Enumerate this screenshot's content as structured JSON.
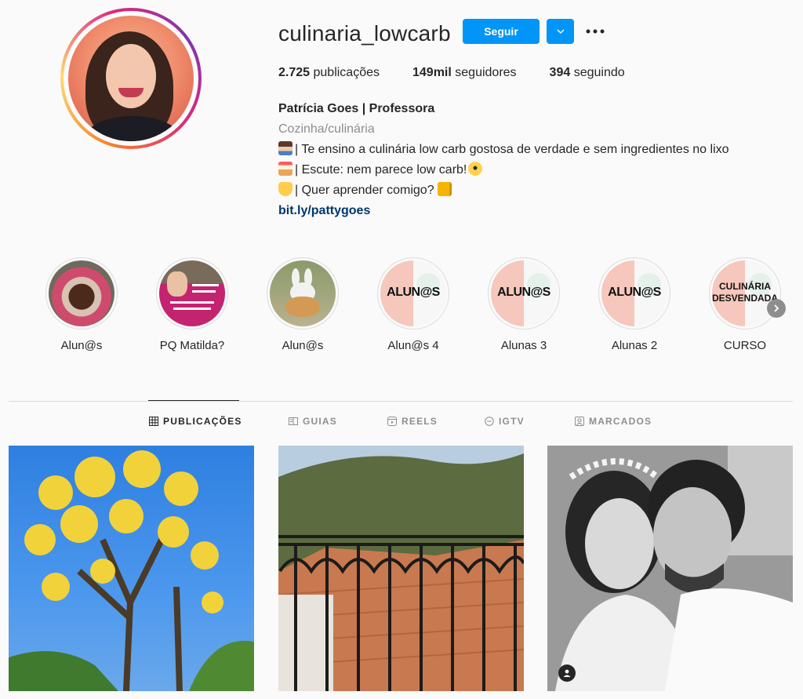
{
  "profile": {
    "username": "culinaria_lowcarb",
    "follow_label": "Seguir",
    "stats": {
      "posts_count": "2.725",
      "posts_label": "publicações",
      "followers_count": "149mil",
      "followers_label": "seguidores",
      "following_count": "394",
      "following_label": "seguindo"
    },
    "bio": {
      "name": "Patrícia Goes | Professora",
      "category": "Cozinha/culinária",
      "line1": "| Te ensino a culinária low carb gostosa de verdade e sem ingredientes no lixo",
      "line2": "| Escute: nem parece low carb!",
      "line3": "| Quer aprender comigo?",
      "link": "bit.ly/pattygoes"
    }
  },
  "highlights": [
    {
      "label": "Alun@s"
    },
    {
      "label": "PQ Matilda?"
    },
    {
      "label": "Alun@s"
    },
    {
      "label": "Alun@s 4",
      "cover_text": "ALUN@S"
    },
    {
      "label": "Alunas 3",
      "cover_text": "ALUN@S"
    },
    {
      "label": "Alunas 2",
      "cover_text": "ALUN@S"
    },
    {
      "label": "CURSO",
      "cover_text_line1": "CULINÁRIA",
      "cover_text_line2": "DESVENDADA"
    }
  ],
  "tabs": [
    {
      "label": "PUBLICAÇÕES",
      "icon": "grid-icon",
      "active": true
    },
    {
      "label": "GUIAS",
      "icon": "guide-icon"
    },
    {
      "label": "REELS",
      "icon": "reels-icon"
    },
    {
      "label": "IGTV",
      "icon": "igtv-icon"
    },
    {
      "label": "MARCADOS",
      "icon": "tagged-icon"
    }
  ],
  "colors": {
    "accent": "#0095f6",
    "link": "#00376b",
    "muted": "#8e8e8e"
  }
}
